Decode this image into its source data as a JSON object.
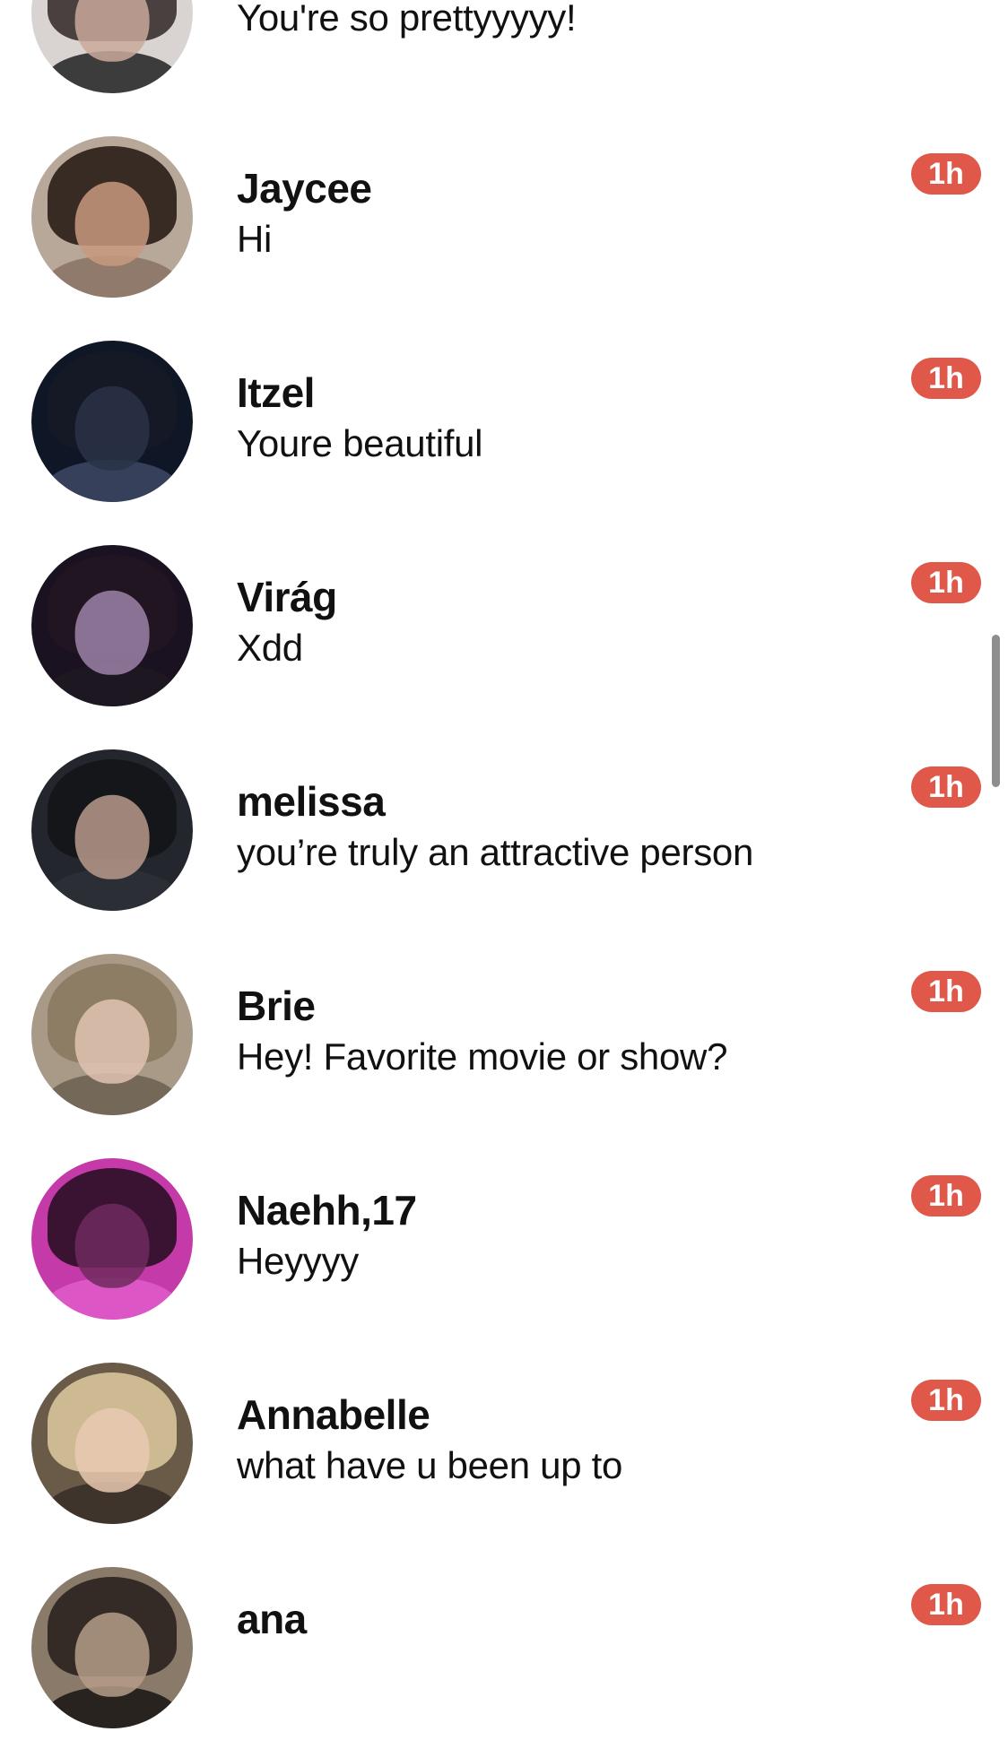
{
  "accent_color": "#e0584a",
  "conversations": [
    {
      "name": "",
      "message": "You're so prettyyyyy!",
      "time": "",
      "avatar_icon": "profile-photo-icon",
      "colors": {
        "bg": "#d9d4d1",
        "hair": "#3a3030",
        "face": "#c9a99a",
        "shoulders": "#2b2b2b"
      }
    },
    {
      "name": "Jaycee",
      "message": "Hi",
      "time": "1h",
      "avatar_icon": "profile-photo-icon",
      "colors": {
        "bg": "#b7a89a",
        "hair": "#2a1d17",
        "face": "#c89a7e",
        "shoulders": "#8c7466"
      }
    },
    {
      "name": "Itzel",
      "message": "Youre beautiful",
      "time": "1h",
      "avatar_icon": "profile-photo-icon",
      "colors": {
        "bg": "#0f1626",
        "hair": "#151a26",
        "face": "#2a3347",
        "shoulders": "#3b4560"
      }
    },
    {
      "name": "Virág",
      "message": "Xdd",
      "time": "1h",
      "avatar_icon": "profile-photo-icon",
      "colors": {
        "bg": "#1a1220",
        "hair": "#241622",
        "face": "#9c82a8",
        "shoulders": "#1e1822"
      }
    },
    {
      "name": "melissa",
      "message": "you’re truly an attractive person",
      "time": "1h",
      "avatar_icon": "profile-photo-icon",
      "colors": {
        "bg": "#23262c",
        "hair": "#141518",
        "face": "#b89a8c",
        "shoulders": "#2c3036"
      }
    },
    {
      "name": "Brie",
      "message": "Hey! Favorite movie or show?",
      "time": "1h",
      "avatar_icon": "profile-photo-icon",
      "colors": {
        "bg": "#a89a86",
        "hair": "#8a7a62",
        "face": "#e1c3b2",
        "shoulders": "#6e6354"
      }
    },
    {
      "name": "Naehh,17",
      "message": "Heyyyy",
      "time": "1h",
      "avatar_icon": "profile-photo-icon",
      "colors": {
        "bg": "#c43aa8",
        "hair": "#2a1024",
        "face": "#6e2a5e",
        "shoulders": "#e05ac8"
      }
    },
    {
      "name": "Annabelle",
      "message": "what have u been up to",
      "time": "1h",
      "avatar_icon": "profile-photo-icon",
      "colors": {
        "bg": "#6a5a48",
        "hair": "#d9c49a",
        "face": "#e8c9b0",
        "shoulders": "#3a3028"
      }
    },
    {
      "name": "ana",
      "message": "",
      "time": "1h",
      "avatar_icon": "profile-photo-icon",
      "colors": {
        "bg": "#8a7a6a",
        "hair": "#2a2220",
        "face": "#b59c88",
        "shoulders": "#1e1a18"
      }
    }
  ]
}
